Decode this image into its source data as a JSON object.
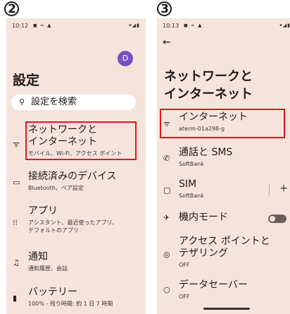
{
  "left": {
    "step": "2",
    "status": {
      "time": "10:12",
      "icons": "◼ ∞ ▲",
      "right": "▾◢▮"
    },
    "avatar": "D",
    "title": "設定",
    "search_placeholder": "設定を検索",
    "items": [
      {
        "t1": "ネットワークと",
        "t1b": "インターネット",
        "t2": "モバイル、Wi-Fi、アクセス ポイント",
        "icon": "wifi-icon"
      },
      {
        "t1": "接続済みのデバイス",
        "t2": "Bluetooth、ペア設定",
        "icon": "devices-icon"
      },
      {
        "t1": "アプリ",
        "t2": "アシスタント、最近使ったアプリ、",
        "t3": "デフォルトのアプリ",
        "icon": "apps-grid-icon"
      },
      {
        "t1": "通知",
        "t2": "通知履歴、会話",
        "icon": "bell-icon"
      },
      {
        "t1": "バッテリー",
        "t2": "100% - 残り時間: 約 1 日 7 時間",
        "icon": "battery-icon"
      }
    ]
  },
  "right": {
    "step": "3",
    "status": {
      "time": "10:13",
      "icons": "◼ ∞ ▲",
      "right": "▾◢▮"
    },
    "title_line1": "ネットワークと",
    "title_line2": "インターネット",
    "items": [
      {
        "t1": "インターネット",
        "t2": "aterm-01a298-g",
        "icon": "wifi-icon"
      },
      {
        "t1": "通話と SMS",
        "t2": "SoftBank",
        "icon": "call-sms-icon"
      },
      {
        "t1": "SIM",
        "t2": "SoftBank",
        "icon": "sim-icon"
      },
      {
        "t1": "機内モード",
        "icon": "airplane-icon"
      },
      {
        "t1": "アクセス ポイントと",
        "t1b": "テザリング",
        "t2": "OFF",
        "icon": "hotspot-icon"
      },
      {
        "t1": "データセーバー",
        "t2": "OFF",
        "icon": "data-saver-icon"
      }
    ]
  },
  "colors": {
    "bg": "#f5e4dc",
    "highlight": "#e5141e",
    "avatar": "#7a4fc0"
  }
}
